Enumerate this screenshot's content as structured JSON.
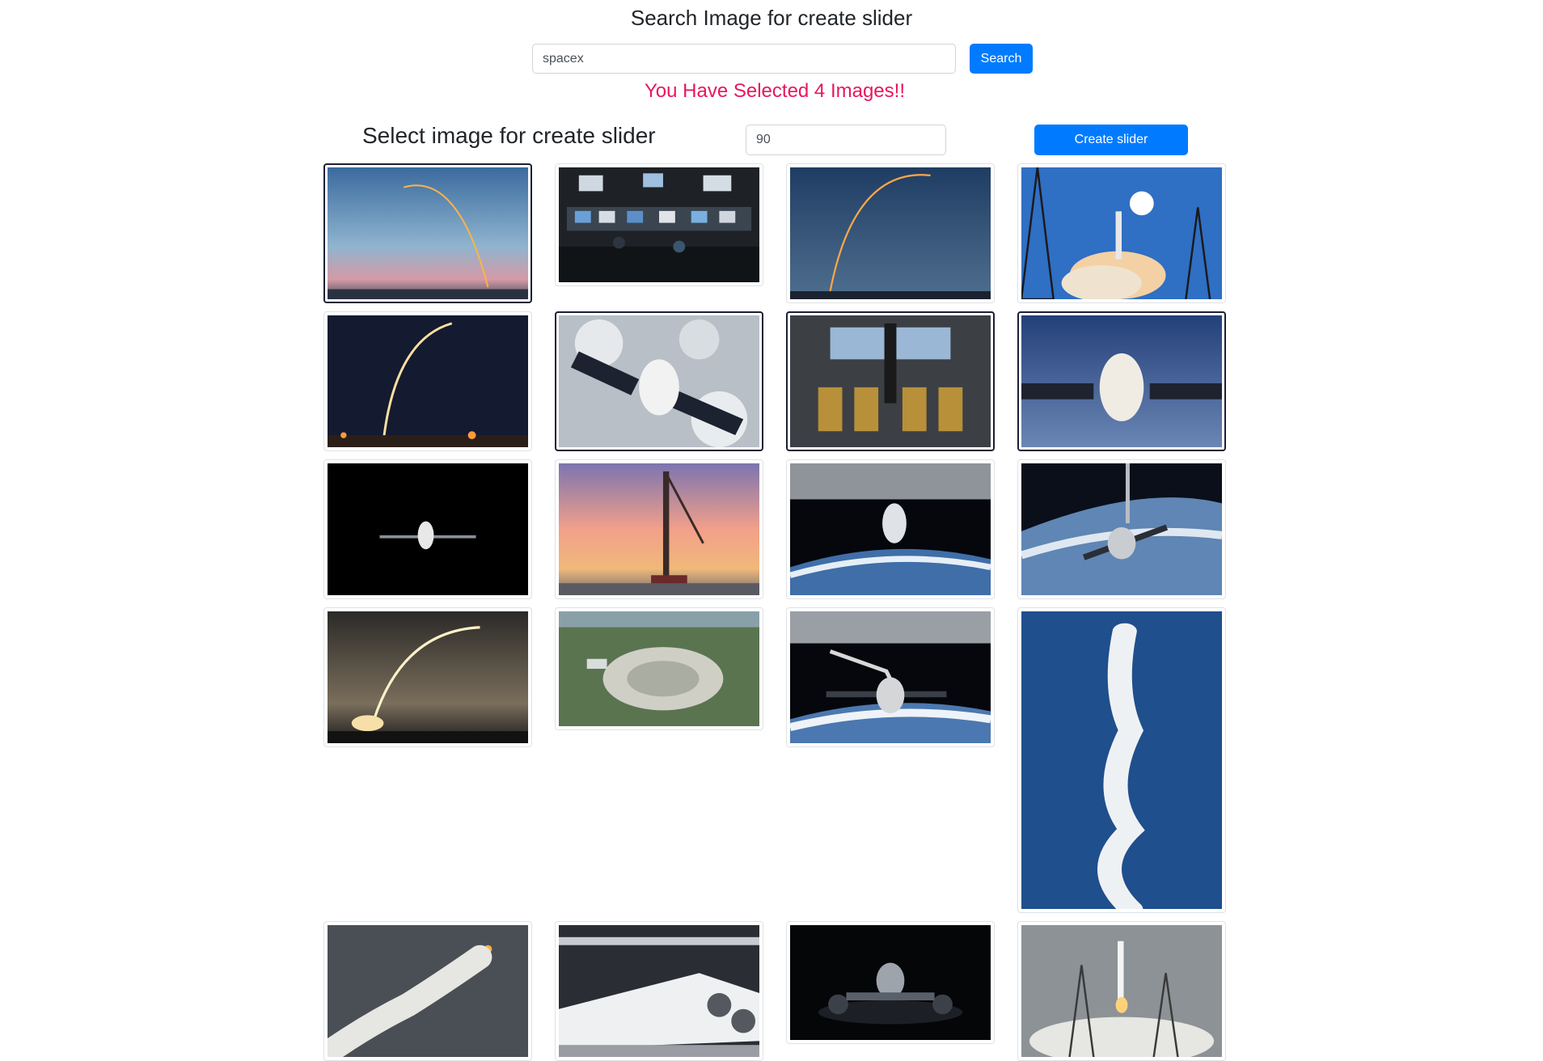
{
  "header": {
    "search_title": "Search Image for create slider",
    "search_value": "spacex",
    "search_button": "Search",
    "selected_message": "You Have Selected 4 Images!!"
  },
  "slider": {
    "select_title": "Select image for create slider",
    "duration_value": "90",
    "create_button": "Create slider"
  },
  "colors": {
    "accent": "#007bff",
    "message": "#e8175d",
    "selected_border": "#1a1f36"
  },
  "images": [
    {
      "subject": "rocket-launch-arc-dusk",
      "selected": true
    },
    {
      "subject": "mission-control-room",
      "selected": false
    },
    {
      "subject": "rocket-launch-arc-blue",
      "selected": false
    },
    {
      "subject": "rocket-liftoff-launch-tower",
      "selected": false
    },
    {
      "subject": "night-launch-streak",
      "selected": false
    },
    {
      "subject": "dragon-capsule-over-clouds",
      "selected": true
    },
    {
      "subject": "crew-dragon-interior",
      "selected": true
    },
    {
      "subject": "dragon-capsule-over-earth",
      "selected": true
    },
    {
      "subject": "dragon-capsule-black-space",
      "selected": false
    },
    {
      "subject": "rocket-on-pad-sunset",
      "selected": false
    },
    {
      "subject": "dragon-docked-station",
      "selected": false
    },
    {
      "subject": "dragon-capsule-robotic-arm-earth",
      "selected": false
    },
    {
      "subject": "long-exposure-launch-arc",
      "selected": false
    },
    {
      "subject": "launch-complex-aerial",
      "selected": false
    },
    {
      "subject": "dragon-grappled-by-station-arm",
      "selected": false
    },
    {
      "subject": "rocket-smoke-trail-vertical",
      "selected": false
    },
    {
      "subject": "rocket-smoke-trail-diagonal",
      "selected": false
    },
    {
      "subject": "falcon-engines-hangar",
      "selected": false
    },
    {
      "subject": "rover-vehicle-dark",
      "selected": false
    },
    {
      "subject": "rocket-liftoff-smoke-pad",
      "selected": false
    }
  ]
}
